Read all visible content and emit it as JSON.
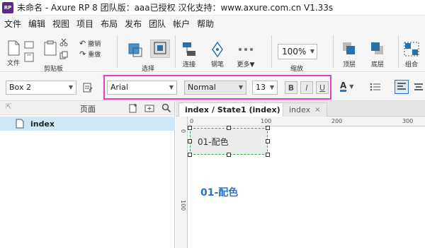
{
  "window": {
    "app_icon": "RP",
    "title": "未命名 - Axure RP 8 团队版：aaa已授权 汉化支持：www.axure.com.cn V1.33s"
  },
  "menu": [
    "文件",
    "编辑",
    "视图",
    "项目",
    "布局",
    "发布",
    "团队",
    "帐户",
    "帮助"
  ],
  "toolbar": {
    "file_label": "文件",
    "clipboard_label": "剪贴板",
    "undo_label": "撤销",
    "redo_label": "重做",
    "select_label": "选择",
    "connect_label": "连接",
    "pen_label": "钢笔",
    "more_label": "更多▼",
    "zoom_value": "100%",
    "zoom_label": "缩放",
    "top_label": "顶层",
    "bottom_label": "底层",
    "group_label": "组合"
  },
  "format": {
    "widget_name": "Box 2",
    "font_family": "Arial",
    "font_style": "Normal",
    "font_size": "13",
    "bold": "B",
    "italic": "I",
    "underline": "U",
    "text_color_label": "A"
  },
  "pages_panel": {
    "title": "页面",
    "items": [
      {
        "label": "index"
      }
    ]
  },
  "tabs": [
    {
      "label": "index / State1 (index)",
      "close": "×"
    },
    {
      "label": "index",
      "close": "×"
    }
  ],
  "ruler": {
    "h_labels": [
      "0",
      "100",
      "200",
      "300"
    ],
    "v_labels": [
      "0",
      "100"
    ]
  },
  "canvas": {
    "shape_text": "01-配色",
    "heading_text": "01-配色"
  },
  "colors": {
    "highlight": "#e040c0",
    "heading": "#2e73c7",
    "selected_page": "#cfe8f7"
  }
}
